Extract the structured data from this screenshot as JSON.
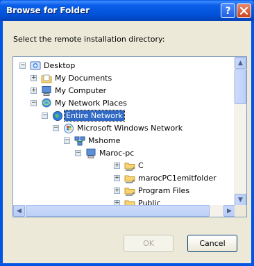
{
  "window": {
    "title": "Browse for Folder",
    "help_glyph": "?",
    "close_glyph": "✕"
  },
  "prompt": "Select the remote installation directory:",
  "tree": {
    "items": [
      {
        "label": "Desktop",
        "icon": "desktop-icon",
        "expander": "−"
      },
      {
        "label": "My Documents",
        "icon": "folder-icon",
        "expander": "+"
      },
      {
        "label": "My Computer",
        "icon": "computer-icon",
        "expander": "+"
      },
      {
        "label": "My Network Places",
        "icon": "network-places-icon",
        "expander": "−"
      },
      {
        "label": "Entire Network",
        "icon": "globe-icon",
        "expander": "−",
        "selected": true
      },
      {
        "label": "Microsoft Windows Network",
        "icon": "windows-network-icon",
        "expander": "−"
      },
      {
        "label": "Mshome",
        "icon": "workgroup-icon",
        "expander": "−"
      },
      {
        "label": "Maroc-pc",
        "icon": "computer-icon",
        "expander": "−"
      },
      {
        "label": "C",
        "icon": "shared-folder-icon",
        "expander": "+"
      },
      {
        "label": "marocPC1emitfolder",
        "icon": "shared-folder-icon",
        "expander": "+"
      },
      {
        "label": "Program Files",
        "icon": "shared-folder-icon",
        "expander": "+"
      },
      {
        "label": "Public",
        "icon": "shared-folder-icon",
        "expander": "+"
      }
    ]
  },
  "buttons": {
    "ok": "OK",
    "cancel": "Cancel"
  },
  "colors": {
    "titlebar": "#0055e5",
    "selection": "#316ac5",
    "dialog_bg": "#ece9d8"
  }
}
